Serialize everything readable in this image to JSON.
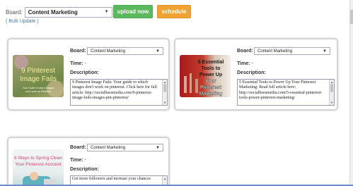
{
  "toolbar": {
    "board_label": "Board:",
    "board_value": "Content Marketing",
    "upload_label": "upload now",
    "schedule_label": "schedule",
    "bulk_update_label": "( Bulk Update )"
  },
  "colors": {
    "upload_green": "#5cb85c",
    "schedule_orange": "#f0a330",
    "link_blue": "#3a7bbf"
  },
  "cards": [
    {
      "board_label": "Board:",
      "board_value": "Content Marketing",
      "time_label": "Time:",
      "time_value": "-",
      "description_label": "Description:",
      "description_text": "9 Pinterest Image Fails: Your guide to which images don't work on pinterest.  Click here for full article: http://socialbeesmedia.com/9-pinterest-image-fails-images-pin-pinterest/",
      "image_title": "9 Pinterest Image Fails",
      "image_subtitle": "Your Guide to which images don't work on Pinterest"
    },
    {
      "board_label": "Board:",
      "board_value": "Content Marketing",
      "time_label": "Time:",
      "time_value": "-",
      "description_label": "Description:",
      "description_text": "5 Essential Tools to Power Up Your Pinterest Marketing: Read full article here: http://socialbeesmedia.com/5-essential-pinterest-tools-power-pinterest-marketing/",
      "image_title": "5 Essential Tools to Power Up Your Pinterest Marketing"
    },
    {
      "board_label": "Board:",
      "board_value": "Content Marketing",
      "time_label": "Time:",
      "time_value": "-",
      "description_label": "Description:",
      "description_text": "Get more followers and increase your chances",
      "image_title": "6 Ways to Spring Clean Your Pinterest Account"
    }
  ]
}
